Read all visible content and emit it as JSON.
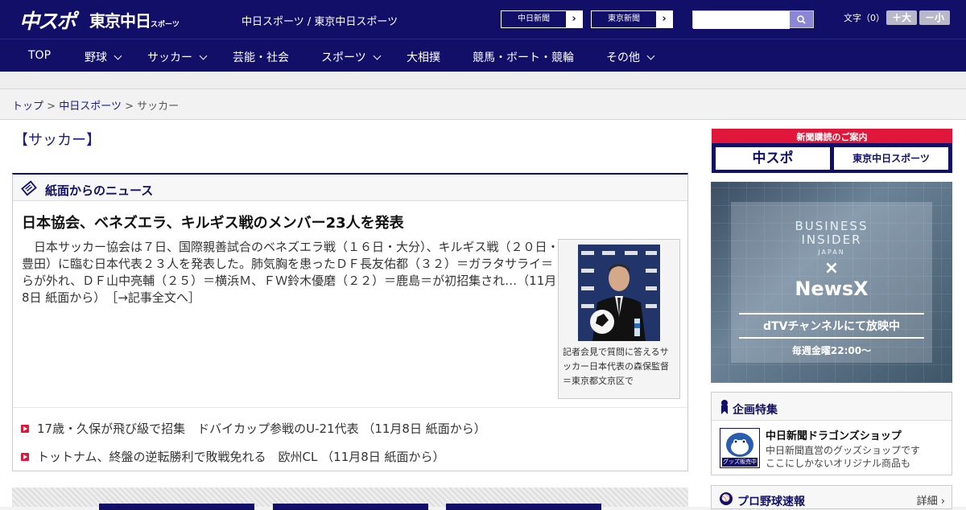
{
  "header": {
    "logo_chuspo": "中スポ",
    "logo_tokyo": "東京中日",
    "logo_tokyo_sub": "スポーツ",
    "site_name": "中日スポーツ / 東京中日スポーツ",
    "ext_links": [
      "中日新聞",
      "東京新聞"
    ],
    "ext_arrow": "›",
    "search_placeholder": "",
    "font_size_label": "文字（0）",
    "font_larger": "＋大",
    "font_smaller": "－小"
  },
  "nav": {
    "items": [
      {
        "label": "TOP"
      },
      {
        "label": "野球"
      },
      {
        "label": "サッカー"
      },
      {
        "label": "芸能・社会"
      },
      {
        "label": "スポーツ"
      },
      {
        "label": "大相撲"
      },
      {
        "label": "競馬・ボート・競輪"
      },
      {
        "label": "その他"
      }
    ]
  },
  "breadcrumb": {
    "top": "トップ",
    "sep1": ">",
    "site": "中日スポーツ",
    "sep2": ">",
    "current": "サッカー"
  },
  "category_title": "【サッカー】",
  "news": {
    "section_title": "紙面からのニュース",
    "headline": "日本協会、ベネズエラ、キルギス戦のメンバー23人を発表",
    "body": "日本サッカー協会は７日、国際親善試合のベネズエラ戦（１６日・大分）、キルギス戦（２０日・豊田）に臨む日本代表２３人を発表した。肺気胸を患ったＤＦ長友佑都（３２）＝ガラタサライ＝らが外れ、ＤＦ山中亮輔（２５）＝横浜Ｍ、ＦＷ鈴木優磨（２２）＝鹿島＝が初招集され…（11月8日 紙面から）",
    "read_more": "［→記事全文へ］",
    "photo_caption": "記者会見で質問に答えるサッカー日本代表の森保監督＝東京都文京区で",
    "related": [
      {
        "label": "17歳・久保が飛び級で招集　ドバイカップ参戦のU-21代表 （11月8日 紙面から）"
      },
      {
        "label": "トットナム、終盤の逆転勝利で敗戦免れる　欧州CL （11月8日 紙面から）"
      }
    ]
  },
  "sidebar": {
    "subscribe_title": "新聞購読のご案内",
    "subscribe_buttons": [
      "中スポ",
      "東京中日スポーツ"
    ],
    "ad": {
      "line1": "BUSINESS",
      "line2": "INSIDER",
      "line3": "JAPAN",
      "cross": "×",
      "brand": "NewsX",
      "channel": "dTVチャンネルにて放映中",
      "schedule": "毎週金曜22:00〜"
    },
    "feature": {
      "title": "企画特集",
      "item_title": "中日新聞ドラゴンズショップ",
      "item_desc_1": "中日新聞直営のグッズショップです",
      "item_desc_2": "ここにしかないオリジナル商品も",
      "thumb_label": "グッズ販売中"
    },
    "pro_baseball": {
      "title": "プロ野球速報",
      "more": "詳細 ›"
    }
  }
}
